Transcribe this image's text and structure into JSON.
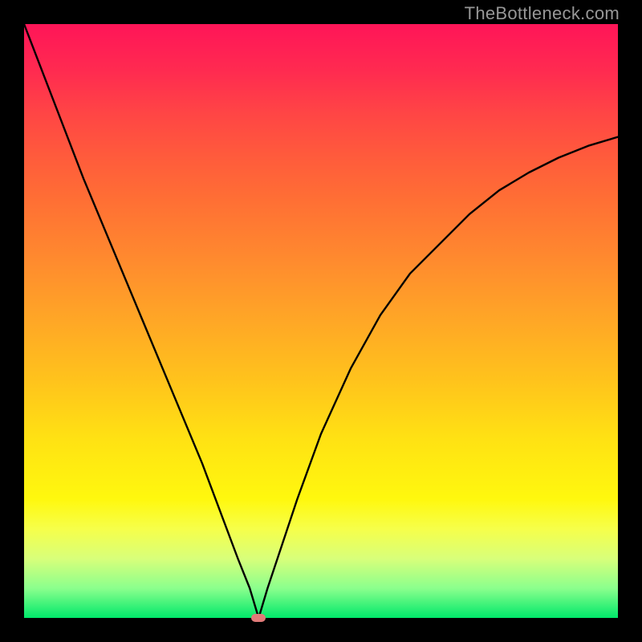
{
  "watermark": "TheBottleneck.com",
  "chart_data": {
    "type": "line",
    "title": "",
    "xlabel": "",
    "ylabel": "",
    "xlim": [
      0,
      100
    ],
    "ylim": [
      0,
      100
    ],
    "grid": false,
    "legend": false,
    "series": [
      {
        "name": "curve",
        "x": [
          0,
          5,
          10,
          15,
          20,
          25,
          30,
          33,
          36,
          38,
          39.5,
          41,
          43,
          46,
          50,
          55,
          60,
          65,
          70,
          75,
          80,
          85,
          90,
          95,
          100
        ],
        "y": [
          100,
          87,
          74,
          62,
          50,
          38,
          26,
          18,
          10,
          5,
          0,
          5,
          11,
          20,
          31,
          42,
          51,
          58,
          63,
          68,
          72,
          75,
          77.5,
          79.5,
          81
        ]
      }
    ],
    "marker": {
      "x": 39.5,
      "y": 0
    },
    "background_gradient": {
      "stops": [
        {
          "pos": 0.0,
          "color": "#ff1558"
        },
        {
          "pos": 0.5,
          "color": "#ffa726"
        },
        {
          "pos": 0.8,
          "color": "#fff80e"
        },
        {
          "pos": 1.0,
          "color": "#00e86a"
        }
      ]
    }
  }
}
